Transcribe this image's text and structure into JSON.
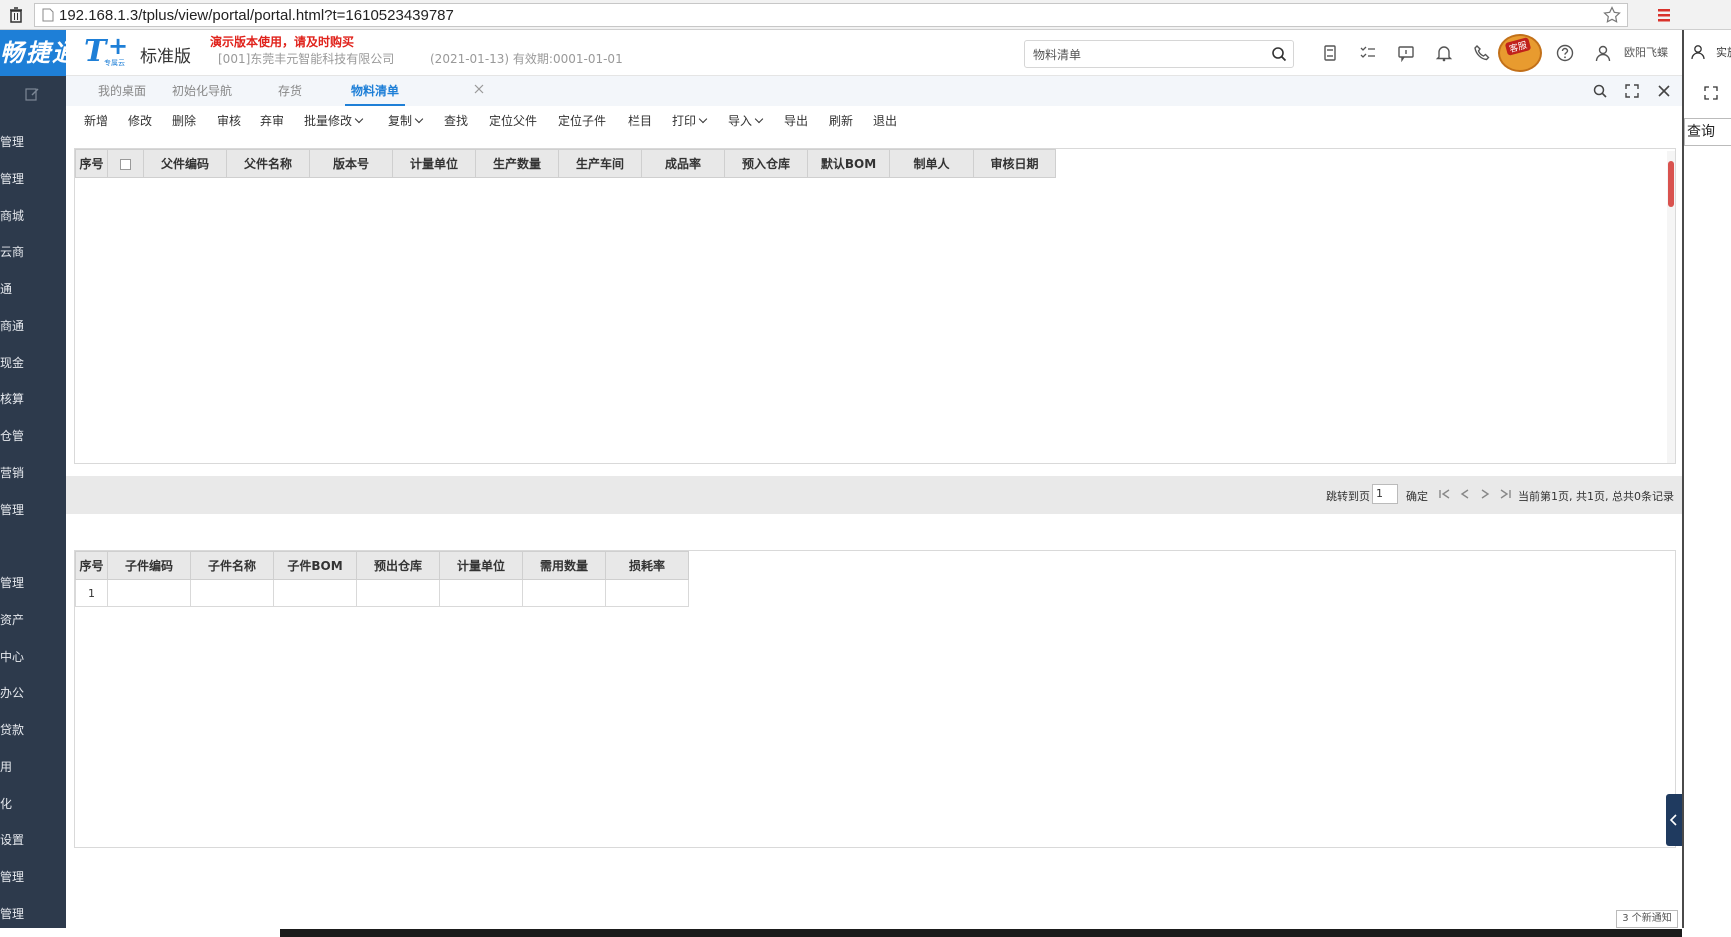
{
  "browser": {
    "url": "192.168.1.3/tplus/view/portal/portal.html?t=1610523439787"
  },
  "sidebar": {
    "brand": "畅捷通",
    "items": [
      {
        "label": "管理"
      },
      {
        "label": "管理"
      },
      {
        "label": "商城"
      },
      {
        "label": "云商"
      },
      {
        "label": "通"
      },
      {
        "label": "商通"
      },
      {
        "label": "现金"
      },
      {
        "label": "核算"
      },
      {
        "label": "仓管"
      },
      {
        "label": "营销"
      },
      {
        "label": "管理"
      },
      {
        "label": "管理"
      },
      {
        "label": "资产"
      },
      {
        "label": "中心"
      },
      {
        "label": "办公"
      },
      {
        "label": "贷款"
      },
      {
        "label": "用"
      },
      {
        "label": "化"
      },
      {
        "label": "设置"
      },
      {
        "label": "管理"
      },
      {
        "label": "管理"
      }
    ]
  },
  "header": {
    "logo_t": "T",
    "logo_plus": "+",
    "logo_sub": "专属云",
    "edition": "标准版",
    "demo_warning": "演示版本使用，请及时购买",
    "company": "[001]东莞丰元智能科技有限公司",
    "period": "(2021-01-13)   有效期:0001-01-01",
    "search_value": "物料清单",
    "kefu_label": "客服",
    "username": "欧阳飞蝶"
  },
  "right_panel": {
    "text": "实施",
    "query": "查询"
  },
  "tabs": [
    {
      "label": "我的桌面"
    },
    {
      "label": "初始化导航"
    },
    {
      "label": "存货"
    },
    {
      "label": "物料清单"
    }
  ],
  "toolbar": [
    {
      "label": "新增",
      "dropdown": false
    },
    {
      "label": "修改",
      "dropdown": false
    },
    {
      "label": "删除",
      "dropdown": false
    },
    {
      "label": "审核",
      "dropdown": false
    },
    {
      "label": "弃审",
      "dropdown": false
    },
    {
      "label": "批量修改",
      "dropdown": true
    },
    {
      "label": "复制",
      "dropdown": true
    },
    {
      "label": "查找",
      "dropdown": false
    },
    {
      "label": "定位父件",
      "dropdown": false
    },
    {
      "label": "定位子件",
      "dropdown": false
    },
    {
      "label": "栏目",
      "dropdown": false
    },
    {
      "label": "打印",
      "dropdown": true
    },
    {
      "label": "导入",
      "dropdown": true
    },
    {
      "label": "导出",
      "dropdown": false
    },
    {
      "label": "刷新",
      "dropdown": false
    },
    {
      "label": "退出",
      "dropdown": false
    }
  ],
  "parent_grid": {
    "columns": [
      "序号",
      "",
      "父件编码",
      "父件名称",
      "版本号",
      "计量单位",
      "生产数量",
      "生产车间",
      "成品率",
      "预入仓库",
      "默认BOM",
      "制单人",
      "审核日期"
    ],
    "rows": []
  },
  "pager": {
    "jump_label": "跳转到页",
    "page_value": "1",
    "confirm": "确定",
    "summary": "当前第1页, 共1页, 总共0条记录"
  },
  "child_grid": {
    "columns": [
      "序号",
      "子件编码",
      "子件名称",
      "子件BOM",
      "预出仓库",
      "计量单位",
      "需用数量",
      "损耗率"
    ],
    "rows": [
      [
        "1",
        "",
        "",
        "",
        "",
        "",
        "",
        ""
      ]
    ]
  },
  "notification": "3 个新通知"
}
